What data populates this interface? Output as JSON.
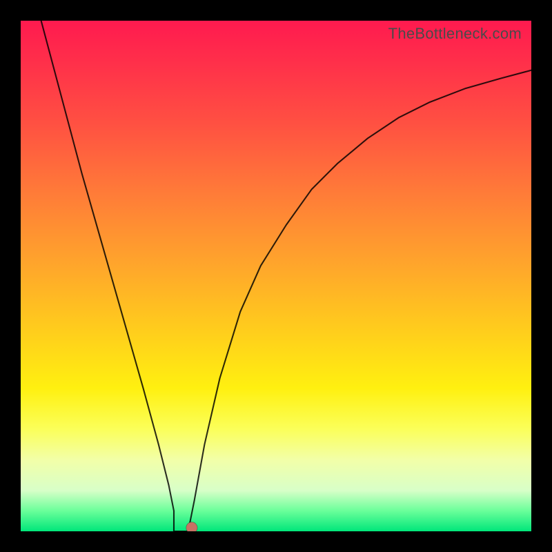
{
  "watermark": "TheBottleneck.com",
  "chart_data": {
    "type": "line",
    "title": "",
    "xlabel": "",
    "ylabel": "",
    "xlim": [
      0,
      1
    ],
    "ylim": [
      0,
      1
    ],
    "series": [
      {
        "name": "bottleneck-curve",
        "x": [
          0.04,
          0.08,
          0.12,
          0.16,
          0.2,
          0.24,
          0.27,
          0.29,
          0.3,
          0.3,
          0.33,
          0.33,
          0.34,
          0.36,
          0.39,
          0.43,
          0.47,
          0.52,
          0.57,
          0.62,
          0.68,
          0.74,
          0.8,
          0.87,
          0.94,
          1.0
        ],
        "y": [
          1.0,
          0.85,
          0.7,
          0.56,
          0.42,
          0.28,
          0.17,
          0.09,
          0.04,
          0.0,
          0.0,
          0.01,
          0.06,
          0.17,
          0.3,
          0.43,
          0.52,
          0.6,
          0.67,
          0.72,
          0.77,
          0.81,
          0.84,
          0.867,
          0.887,
          0.903
        ]
      }
    ],
    "marker": {
      "x": 0.335,
      "y": 0.007,
      "r": 0.011
    },
    "annotations": []
  }
}
